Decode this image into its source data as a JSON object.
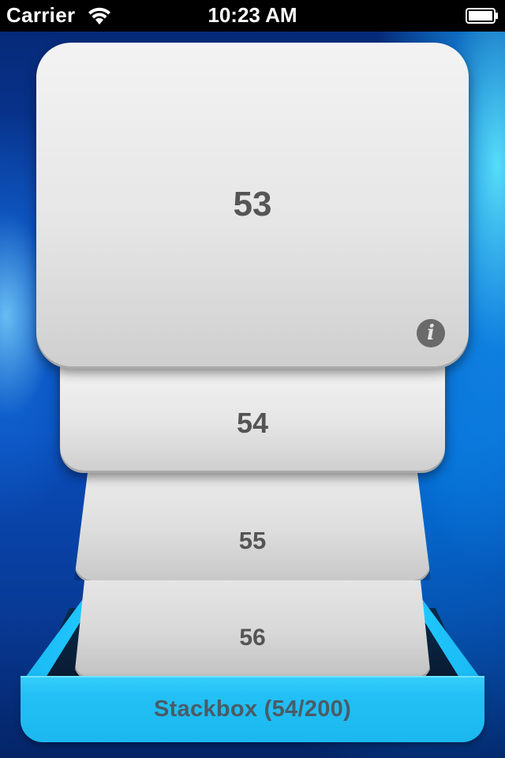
{
  "status_bar": {
    "carrier": "Carrier",
    "time": "10:23 AM",
    "wifi_icon": "wifi-icon",
    "battery_icon": "battery-full-icon"
  },
  "cards": [
    {
      "number": "53"
    },
    {
      "number": "54"
    },
    {
      "number": "55"
    },
    {
      "number": "56"
    }
  ],
  "info_icon_glyph": "i",
  "tray": {
    "label": "Stackbox (54/200)"
  },
  "colors": {
    "background_blue": "#0a4dbb",
    "tray_cyan": "#22c0f5",
    "card_text": "#555555",
    "tray_text": "#4b5b66"
  }
}
